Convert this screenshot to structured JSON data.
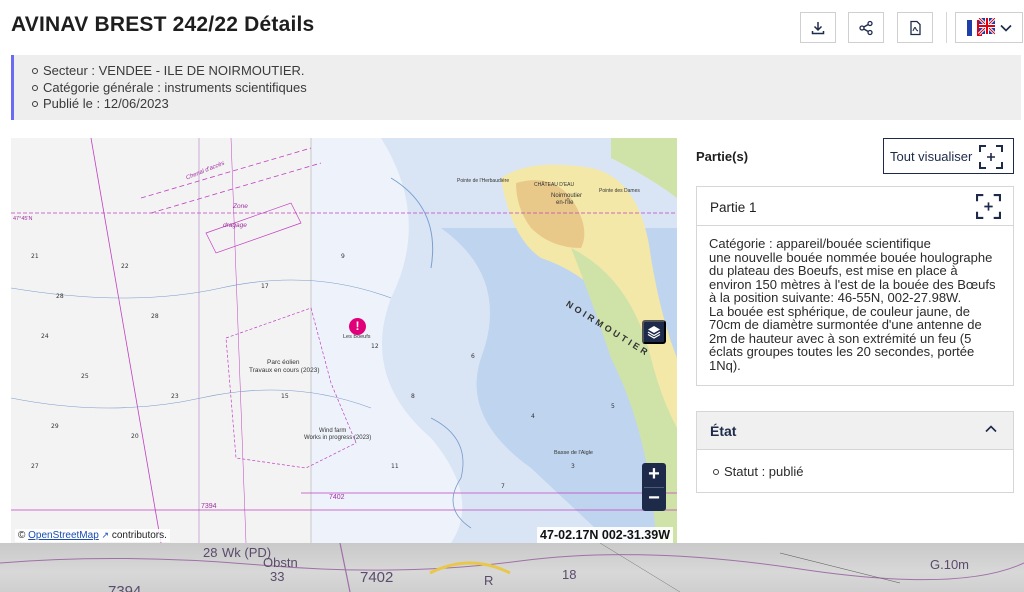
{
  "header": {
    "title": "AVINAV BREST 242/22 Détails",
    "actions": {
      "download_icon": "download-icon",
      "share_icon": "share-icon",
      "pdf_icon": "pdf-icon",
      "language_icon": "flag-fr-uk-icon"
    }
  },
  "info": {
    "items": [
      "Secteur : VENDEE - ILE DE NOIRMOUTIER.",
      "Catégorie générale : instruments scientifiques",
      "Publié le : 12/06/2023"
    ]
  },
  "map": {
    "attribution_prefix": "©",
    "attribution_link": "OpenStreetMap",
    "attribution_suffix": "contributors.",
    "coordinates": "47-02.17N 002-31.39W",
    "zoom_in": "+",
    "zoom_out": "−",
    "labels": {
      "noirmoutier": "NOIRMOUTIER",
      "parc_eolien": "Parc éolien",
      "travaux": "Travaux en cours (2023)",
      "wind_farm": "Wind farm",
      "works": "Works in progress (2023)",
      "zone": "Zone",
      "dragage": "dragage",
      "chenal": "Chenal d'accès",
      "les_boeufs": "Les Boeufs",
      "noirmoutier_town": "Noirmoutier",
      "en_ile": "en-l'Île",
      "pointe_herbaudiere": "Pointe de l'Herbaudière",
      "pointe_dames": "Pointe des Dames",
      "chateau": "CHÂTEAU D'EAU",
      "basse_aigle": "Basse de l'Aigle",
      "num_7394": "7394",
      "num_7402": "7402",
      "lat_4745": "47°45'N"
    }
  },
  "parts": {
    "title": "Partie(s)",
    "view_all_label": "Tout visualiser",
    "items": [
      {
        "label": "Partie 1",
        "text": "Catégorie : appareil/bouée scientifique\nune nouvelle bouée nommée bouée houlographe du plateau des Boeufs, est mise en place à environ 150 mètres à l'est de la bouée des Bœufs à la position suivante: 46-55N, 002-27.98W.\nLa bouée est sphérique, de couleur jaune, de 70cm de diamètre surmontée d'une antenne de 2m de hauteur avec à son extrémité un feu (5 éclats groupes toutes les 20 secondes, portée 1Nq)."
      }
    ]
  },
  "etat": {
    "title": "État",
    "status": "Statut : publié"
  },
  "background": {
    "labels": [
      "28",
      "Wk (PD)",
      "Obstn",
      "33",
      "7402",
      "7394",
      "18",
      "G.10m",
      "R"
    ]
  }
}
